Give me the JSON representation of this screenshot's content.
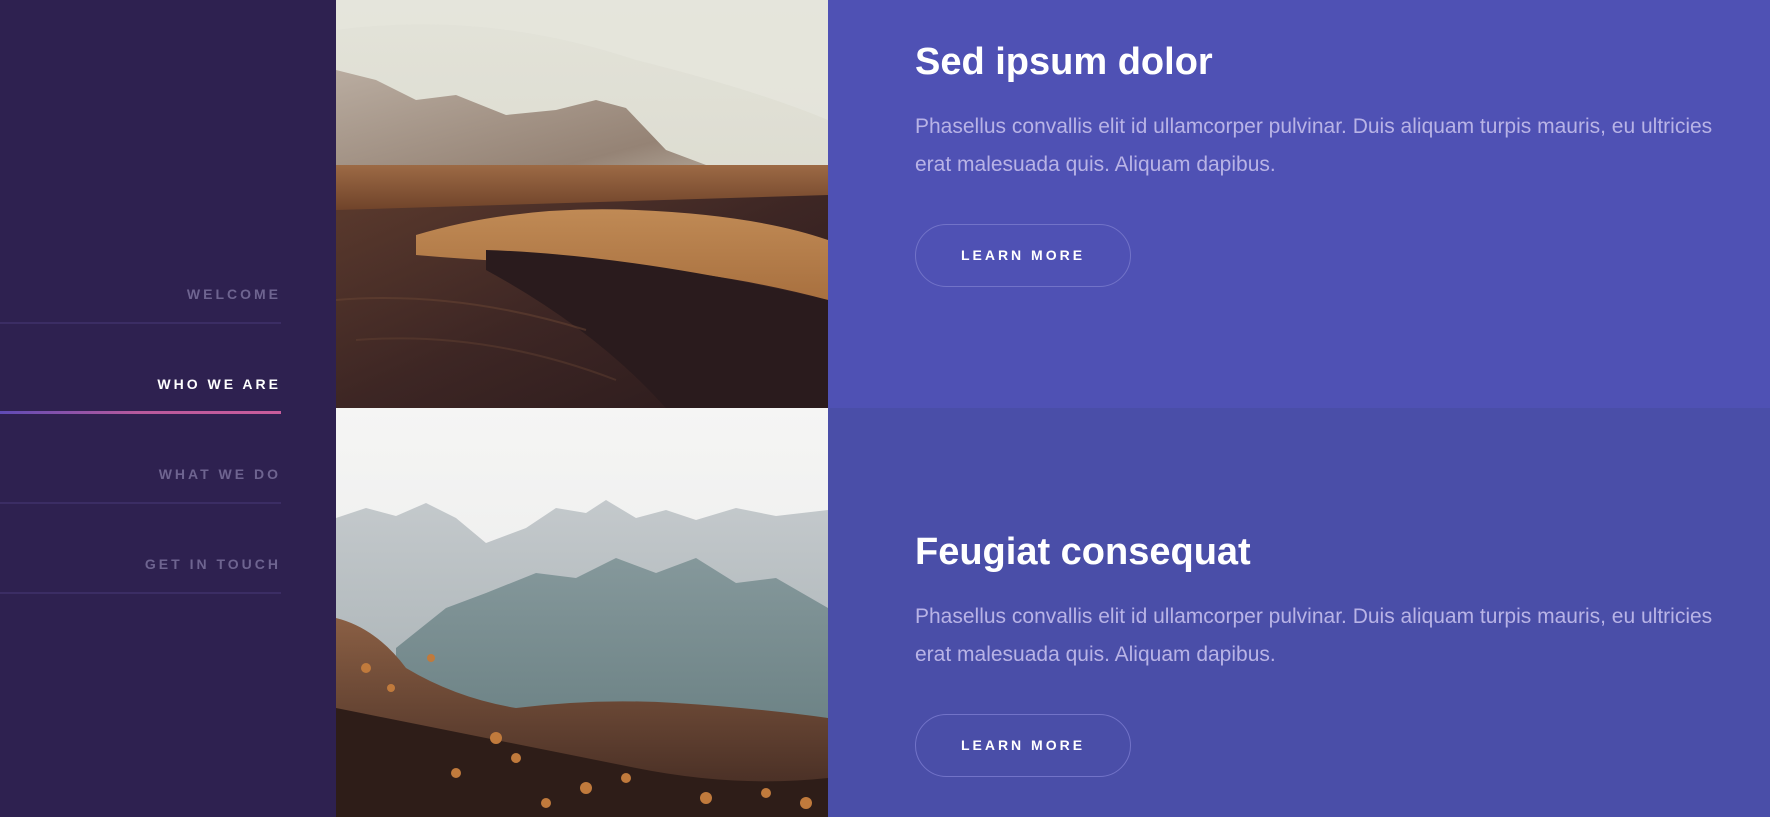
{
  "nav": {
    "items": [
      {
        "label": "WELCOME"
      },
      {
        "label": "WHO WE ARE",
        "active": true
      },
      {
        "label": "WHAT WE DO"
      },
      {
        "label": "GET IN TOUCH"
      }
    ]
  },
  "sections": [
    {
      "title": "Sed ipsum dolor",
      "text": "Phasellus convallis elit id ullamcorper pulvinar. Duis aliquam turpis mauris, eu ultricies erat malesuada quis. Aliquam dapibus.",
      "button": "LEARN MORE"
    },
    {
      "title": "Feugiat consequat",
      "text": "Phasellus convallis elit id ullamcorper pulvinar. Duis aliquam turpis mauris, eu ultricies erat malesuada quis. Aliquam dapibus.",
      "button": "LEARN MORE"
    }
  ],
  "colors": {
    "sidebar_bg": "#2e2150",
    "section1_bg": "#4f51b4",
    "section2_bg": "#4a4ea8",
    "active_underline": "#c95c9b"
  }
}
